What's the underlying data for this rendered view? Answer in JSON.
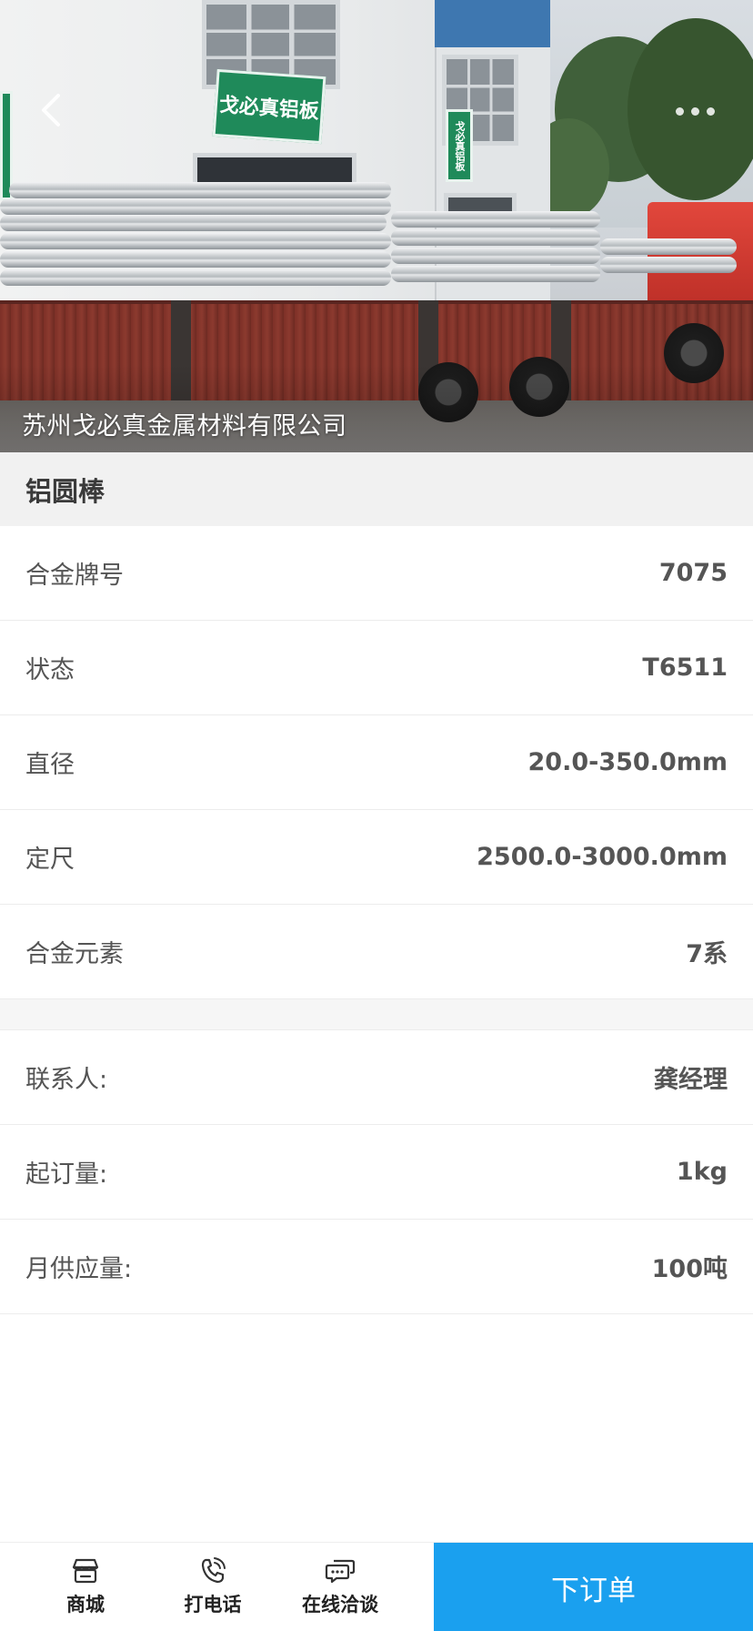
{
  "hero": {
    "company_name": "苏州戈必真金属材料有限公司",
    "sign_main_text": "戈必真铝板",
    "sign_side_text": "戈必真铝板"
  },
  "product": {
    "title": "铝圆棒"
  },
  "specs": [
    {
      "label": "合金牌号",
      "value": "7075"
    },
    {
      "label": "状态",
      "value": "T6511"
    },
    {
      "label": "直径",
      "value": "20.0-350.0mm"
    },
    {
      "label": "定尺",
      "value": "2500.0-3000.0mm"
    },
    {
      "label": "合金元素",
      "value": "7系"
    }
  ],
  "contact": [
    {
      "label": "联系人:",
      "value": "龚经理"
    },
    {
      "label": "起订量:",
      "value": "1kg"
    },
    {
      "label": "月供应量:",
      "value": "100吨"
    }
  ],
  "bottom_bar": {
    "shop_label": "商城",
    "call_label": "打电话",
    "chat_label": "在线洽谈",
    "order_label": "下订单"
  },
  "colors": {
    "accent": "#1aa0ef",
    "title_band_bg": "#f1f1f1",
    "sign_green": "#1f8a5a"
  },
  "icons": {
    "back": "chevron-left-icon",
    "more": "more-dots-icon",
    "shop": "storefront-icon",
    "call": "phone-icon",
    "chat": "chat-bubbles-icon"
  }
}
